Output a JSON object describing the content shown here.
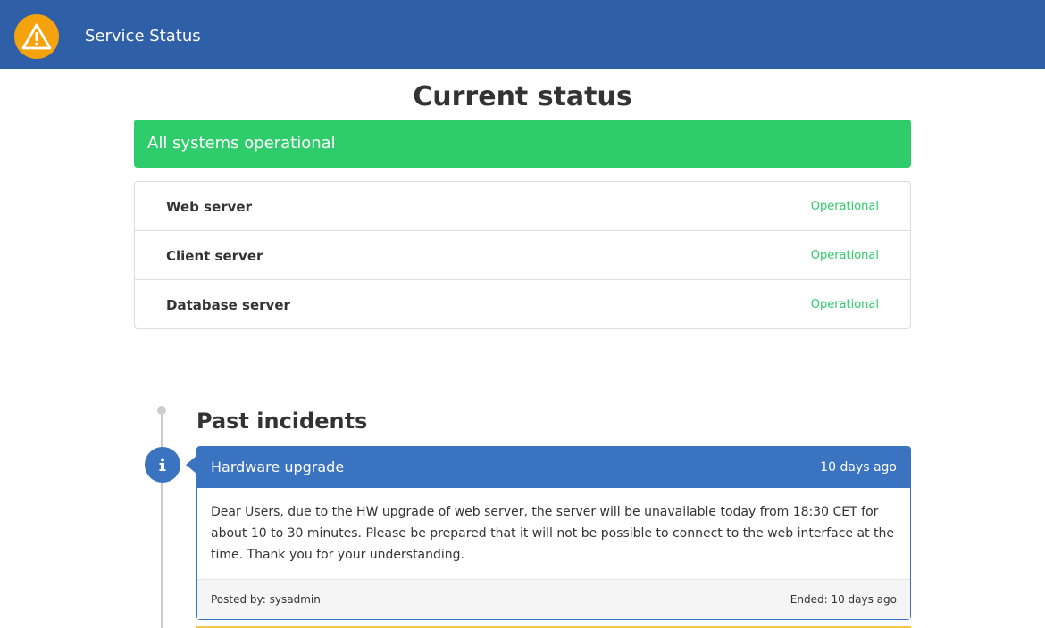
{
  "header": {
    "brand": "Service Status",
    "logo_icon": "warning-icon",
    "background_color": "#2f5fa7",
    "logo_color": "#f4a20d"
  },
  "main": {
    "title": "Current status",
    "overall_status": {
      "label": "All systems operational",
      "color": "#2ecc6a"
    },
    "components": [
      {
        "name": "Web server",
        "status": "Operational"
      },
      {
        "name": "Client server",
        "status": "Operational"
      },
      {
        "name": "Database server",
        "status": "Operational"
      }
    ]
  },
  "incidents": {
    "title": "Past incidents",
    "items": [
      {
        "icon": "info-icon",
        "title": "Hardware upgrade",
        "time_ago": "10 days ago",
        "body": "Dear Users, due to the HW upgrade of web server, the server will be unavailable today from 18:30 CET for about 10 to 30 minutes. Please be prepared that it will not be possible to connect to the web interface at the time. Thank you for your understanding.",
        "posted_by": "Posted by: sysadmin",
        "ended": "Ended: 10 days ago",
        "color": "#3a73c0"
      }
    ]
  }
}
